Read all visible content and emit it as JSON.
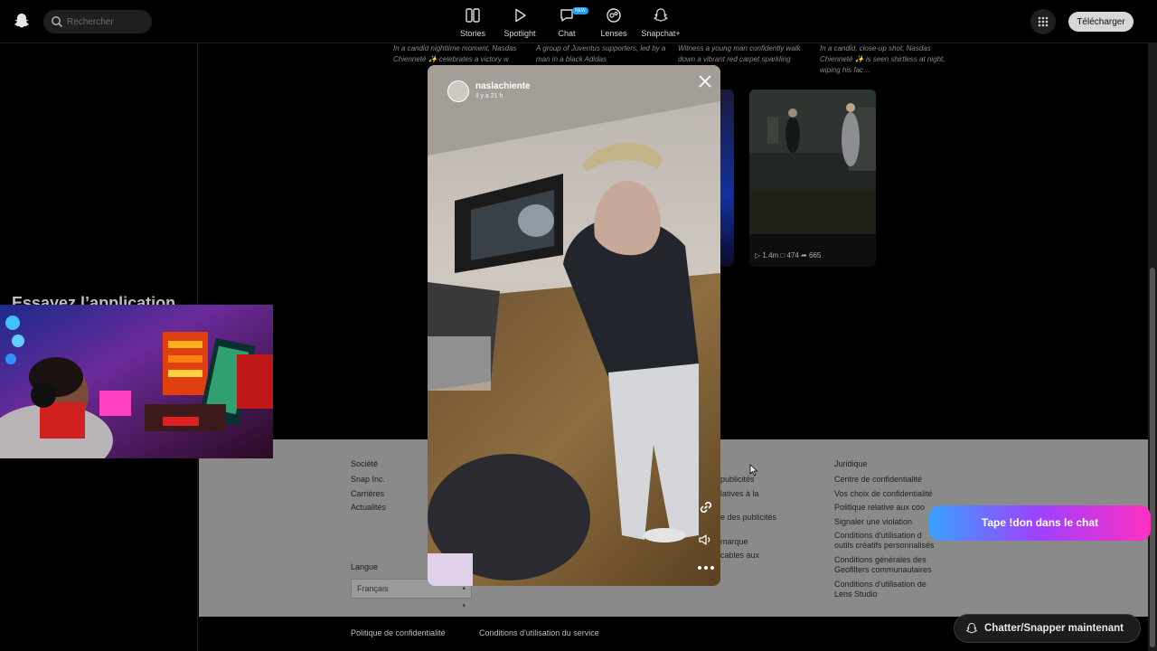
{
  "nav": {
    "search_placeholder": "Rechercher",
    "items": [
      {
        "label": "Stories",
        "icon": "stories-icon"
      },
      {
        "label": "Spotlight",
        "icon": "play-icon"
      },
      {
        "label": "Chat",
        "icon": "chat-icon",
        "badge": "NEW"
      },
      {
        "label": "Lenses",
        "icon": "lenses-icon"
      },
      {
        "label": "Snapchat+",
        "icon": "ghost-icon"
      }
    ],
    "download_label": "Télécharger"
  },
  "left": {
    "try_title": "Essayez l’application de bureau"
  },
  "captions": [
    "In a candid nighttime moment, Nasdas Chienneté ✨ celebrates a victory w",
    "A group of Juventus supporters, led by a man in a black Adidas",
    "Witness a young man confidently walk down a vibrant red carpet sparkling lights….",
    "In a candid, close-up shot, Nasdas Chienneté ✨ is seen shirtless at night, wiping his fac…"
  ],
  "card": {
    "views": "1.4m",
    "comments": "474",
    "shares": "665"
  },
  "story": {
    "username": "naslachiente",
    "time": "Il y a 21 h"
  },
  "footer": {
    "company_title": "Société",
    "company_links": [
      "Snap Inc.",
      "Carrières",
      "Actualités"
    ],
    "ads_links": [
      "publicités",
      "latives à la",
      "e des publicités",
      "marque",
      "cables aux"
    ],
    "legal_title": "Juridique",
    "legal_links": [
      "Centre de confidentialité",
      "Vos choix de confidentialité",
      "Politique relative aux coo",
      "Signaler une violation",
      "Conditions d'utilisation d",
      "outils créatifs personnalisés",
      "Conditions générales des",
      "Geofilters communautaires",
      "Conditions d'utilisation de",
      "Lens Studio"
    ],
    "language_label": "Langue",
    "language_value": "Français",
    "bottom_links": [
      "Politique de confidentialité",
      "Conditions d'utilisation du service"
    ]
  },
  "overlay": {
    "tape_label": "Tape !don dans le chat",
    "chat_label": "Chatter/Snapper maintenant"
  }
}
